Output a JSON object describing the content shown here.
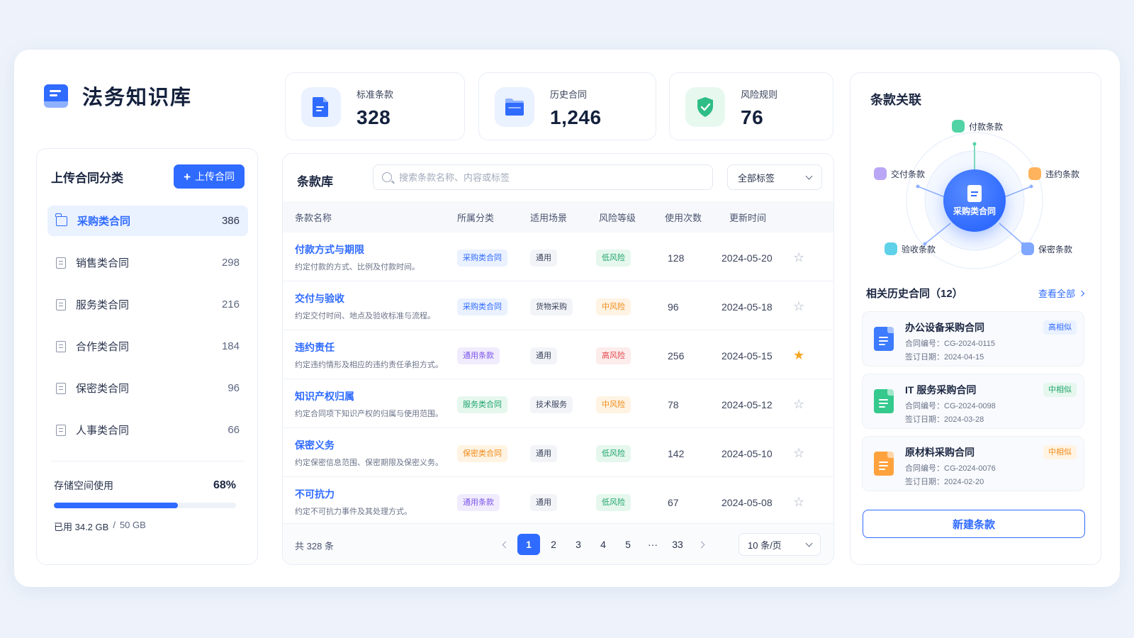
{
  "brand": {
    "title": "法务知识库"
  },
  "stats": [
    {
      "label": "标准条款",
      "value": "328",
      "icon": "document-icon",
      "color": "#2f6bff",
      "bg": "#eaf1ff"
    },
    {
      "label": "历史合同",
      "value": "1,246",
      "icon": "folder-icon",
      "color": "#2f6bff",
      "bg": "#eaf1ff"
    },
    {
      "label": "风险规则",
      "value": "76",
      "icon": "shield-check-icon",
      "color": "#2ebd85",
      "bg": "#e7f8ef"
    }
  ],
  "sidebar": {
    "title": "上传合同分类",
    "upload_label": "上传合同",
    "items": [
      {
        "label": "采购类合同",
        "count": "386",
        "active": true
      },
      {
        "label": "销售类合同",
        "count": "298"
      },
      {
        "label": "服务类合同",
        "count": "216"
      },
      {
        "label": "合作类合同",
        "count": "184"
      },
      {
        "label": "保密类合同",
        "count": "96"
      },
      {
        "label": "人事类合同",
        "count": "66"
      }
    ],
    "storage": {
      "label": "存储空间使用",
      "percent": "68%",
      "fill": 0.68,
      "used": "已用 34.2 GB",
      "sep": "/",
      "total": "50 GB"
    }
  },
  "library": {
    "title": "条款库",
    "search_placeholder": "搜索条款名称、内容或标签",
    "filter_label": "全部标签",
    "columns": {
      "name": "条款名称",
      "category": "所属分类",
      "scene": "适用场景",
      "risk": "风险等级",
      "usage": "使用次数",
      "updated": "更新时间"
    },
    "rows": [
      {
        "name": "付款方式与期限",
        "desc": "约定付款的方式、比例及付款时间。",
        "category": "采购类合同",
        "cat_color": "#2f6bff",
        "cat_bg": "#eaf1ff",
        "scene": "通用",
        "risk": "低风险",
        "risk_color": "#1fa56b",
        "risk_bg": "#e6f7ee",
        "usage": "128",
        "updated": "2024-05-20",
        "starred": false
      },
      {
        "name": "交付与验收",
        "desc": "约定交付时间、地点及验收标准与流程。",
        "category": "采购类合同",
        "cat_color": "#2f6bff",
        "cat_bg": "#eaf1ff",
        "scene": "货物采购",
        "risk": "中风险",
        "risk_color": "#f08c1a",
        "risk_bg": "#fff3e3",
        "usage": "96",
        "updated": "2024-05-18",
        "starred": false
      },
      {
        "name": "违约责任",
        "desc": "约定违约情形及相应的违约责任承担方式。",
        "category": "通用条款",
        "cat_color": "#7b55e8",
        "cat_bg": "#f1ecfd",
        "scene": "通用",
        "risk": "高风险",
        "risk_color": "#e5484d",
        "risk_bg": "#fdecec",
        "usage": "256",
        "updated": "2024-05-15",
        "starred": true
      },
      {
        "name": "知识产权归属",
        "desc": "约定合同项下知识产权的归属与使用范围。",
        "category": "服务类合同",
        "cat_color": "#1fa56b",
        "cat_bg": "#e6f7ee",
        "scene": "技术服务",
        "risk": "中风险",
        "risk_color": "#f08c1a",
        "risk_bg": "#fff3e3",
        "usage": "78",
        "updated": "2024-05-12",
        "starred": false
      },
      {
        "name": "保密义务",
        "desc": "约定保密信息范围、保密期限及保密义务。",
        "category": "保密类合同",
        "cat_color": "#f08c1a",
        "cat_bg": "#fff3e3",
        "scene": "通用",
        "risk": "低风险",
        "risk_color": "#1fa56b",
        "risk_bg": "#e6f7ee",
        "usage": "142",
        "updated": "2024-05-10",
        "starred": false
      },
      {
        "name": "不可抗力",
        "desc": "约定不可抗力事件及其处理方式。",
        "category": "通用条款",
        "cat_color": "#7b55e8",
        "cat_bg": "#f1ecfd",
        "scene": "通用",
        "risk": "低风险",
        "risk_color": "#1fa56b",
        "risk_bg": "#e6f7ee",
        "usage": "67",
        "updated": "2024-05-08",
        "starred": false
      }
    ],
    "total": "共 328 条",
    "pages": [
      "1",
      "2",
      "3",
      "4",
      "5",
      "···",
      "33"
    ],
    "current_page": "1",
    "page_size": "10 条/页"
  },
  "relations": {
    "title": "条款关联",
    "hub": "采购类合同",
    "nodes": [
      {
        "label": "付款条款",
        "color": "#52d3a6"
      },
      {
        "label": "交付条款",
        "color": "#b9a6f5"
      },
      {
        "label": "违约条款",
        "color": "#ffb35c"
      },
      {
        "label": "验收条款",
        "color": "#5fd1e8"
      },
      {
        "label": "保密条款",
        "color": "#7fa7ff"
      }
    ],
    "related_title": "相关历史合同（12）",
    "view_all": "查看全部",
    "contracts": [
      {
        "name": "办公设备采购合同",
        "no": "合同编号：CG-2024-0115",
        "date": "签订日期：2024-04-15",
        "similarity": "高相似",
        "icon_color": "#3d7bff",
        "sim_color": "#2f6bff",
        "sim_bg": "#eaf1ff"
      },
      {
        "name": "IT 服务采购合同",
        "no": "合同编号：CG-2024-0098",
        "date": "签订日期：2024-03-28",
        "similarity": "中相似",
        "icon_color": "#35c98e",
        "sim_color": "#1fa56b",
        "sim_bg": "#e6f7ee"
      },
      {
        "name": "原材料采购合同",
        "no": "合同编号：CG-2024-0076",
        "date": "签订日期：2024-02-20",
        "similarity": "中相似",
        "icon_color": "#ffa23d",
        "sim_color": "#f08c1a",
        "sim_bg": "#fff3e3"
      }
    ],
    "new_clause": "新建条款"
  }
}
